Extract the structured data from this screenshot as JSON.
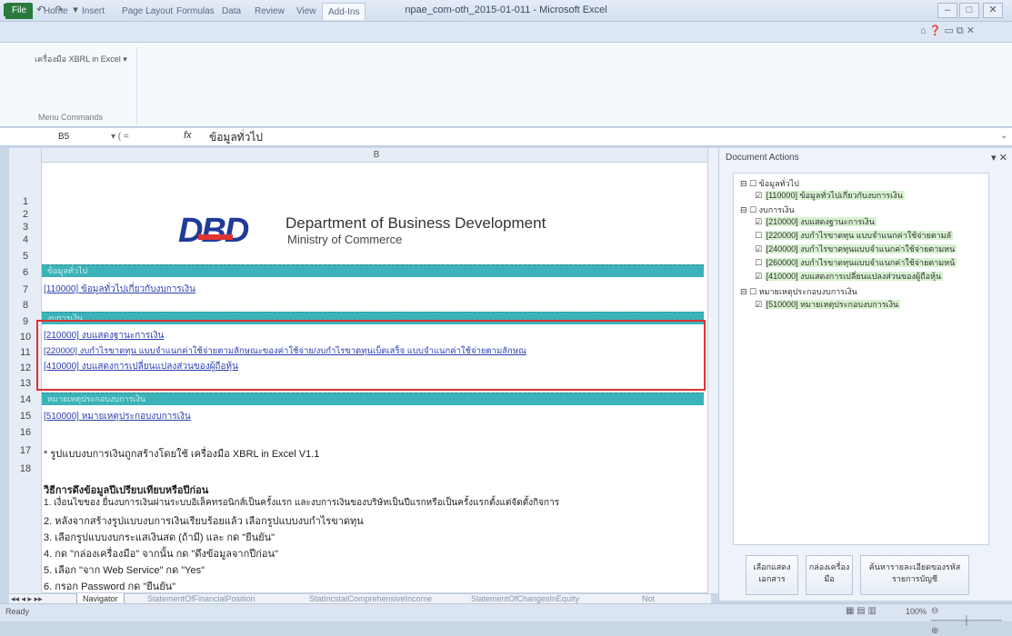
{
  "window": {
    "title": "npae_com-oth_2015-01-011 - Microsoft Excel"
  },
  "ribbon": {
    "file_tab": "File",
    "tabs": [
      "Home",
      "Insert",
      "Page Layout",
      "Formulas",
      "Data",
      "Review",
      "View",
      "Add-Ins"
    ],
    "addin_item": "เครื่องมือ XBRL in Excel",
    "group_label": "Menu Commands"
  },
  "formula_bar": {
    "cell_ref": "B5",
    "fx": "fx",
    "content": "ข้อมูลทั่วไป"
  },
  "grid": {
    "column_header": "B",
    "rows": [
      "1",
      "2",
      "3",
      "4",
      "5",
      "6",
      "7",
      "8",
      "9",
      "10",
      "11",
      "12",
      "13",
      "14",
      "15",
      "16",
      "17",
      "18"
    ],
    "logo_text": "DBD",
    "dept_name": "Department of Business Development",
    "ministry": "Ministry of Commerce",
    "section_general": "ข้อมูลทั่วไป",
    "link_110000": "[110000] ข้อมูลทั่วไปเกี่ยวกับงบการเงิน",
    "section_statements": "งบการเงิน",
    "link_210000": "[210000] งบแสดงฐานะการเงิน",
    "link_220000": "[220000] งบกำไรขาดทุน  แบบจำแนกค่าใช้จ่ายตามลักษณะของค่าใช้จ่าย/งบกำไรขาดทุนเบ็ดเสร็จ  แบบจำแนกค่าใช้จ่ายตามลักษณ",
    "link_410000": "[410000] งบแสดงการเปลี่ยนแปลงส่วนของผู้ถือหุ้น",
    "section_notes": "หมายเหตุประกอบงบการเงิน",
    "link_510000": "[510000] หมายเหตุประกอบงบการเงิน",
    "note_16": "* รูปแบบงบการเงินถูกสร้างโดยใช้ เครื่องมือ XBRL in Excel V1.1",
    "howto_title": "วิธีการดึงข้อมูลปีเปรียบเทียบหรือปีก่อน",
    "steps": [
      "1. เงื่อนไขของ ยื่นงบการเงินผ่านระบบอิเล็คทรอนิกส์เป็นครั้งแรก และงบการเงินของบริษัทเป็นปีแรกหรือเป็นครั้งแรกตั้งแต่จัดตั้งกิจการ",
      "2. หลังจากสร้างรูปแบบงบการเงินเรียบร้อยแล้ว เลือกรูปแบบงบกำไรขาดทุน",
      "3. เลือกรูปแบบงบกระแสเงินสด (ถ้ามี) และ กด \"ยืนยัน\"",
      "4. กด \"กล่องเครื่องมือ\" จากนั้น กด \"ดึงข้อมูลจากปีก่อน\"",
      "5. เลือก \"จาก Web Service\" กด \"Yes\"",
      "6. กรอก Password กด \"ยืนยัน\""
    ]
  },
  "sheet_tabs": [
    "Navigator",
    "StatementOfFinancialPosition",
    "StatIncstatComprehensiveIncome",
    "StatementOfChangesInEquity",
    "Not"
  ],
  "status": {
    "ready": "Ready",
    "zoom": "100%"
  },
  "document_actions": {
    "title": "Document Actions",
    "tree": [
      {
        "label": "ข้อมูลทั่วไป",
        "level": 0
      },
      {
        "label": "[110000] ข้อมูลทั่วไปเกี่ยวกับงบการเงิน",
        "level": 1,
        "checked": true,
        "selected": true
      },
      {
        "label": "งบการเงิน",
        "level": 0
      },
      {
        "label": "[210000] งบแสดงฐานะการเงิน",
        "level": 1,
        "checked": true,
        "selected": true
      },
      {
        "label": "[220000] งบกำไรขาดทุน แบบจำแนกค่าใช้จ่ายตามลั",
        "level": 1,
        "checked": false,
        "selected": true
      },
      {
        "label": "[240000] งบกำไรขาดทุนแบบจำแนกค่าใช้จ่ายตามหน",
        "level": 1,
        "checked": true,
        "selected": true
      },
      {
        "label": "[260000] งบกำไรขาดทุนแบบจำแนกค่าใช้จ่ายตามหน้",
        "level": 1,
        "checked": false,
        "selected": true
      },
      {
        "label": "[410000] งบแสดงการเปลี่ยนแปลงส่วนของผู้ถือหุ้น",
        "level": 1,
        "checked": true,
        "selected": true
      },
      {
        "label": "หมายเหตุประกอบงบการเงิน",
        "level": 0
      },
      {
        "label": "[510000] หมายเหตุประกอบงบการเงิน",
        "level": 1,
        "checked": true,
        "selected": true
      }
    ],
    "buttons": [
      "เลือกแสดงเอกสาร",
      "กล่องเครื่องมือ",
      "ค้นหารายละเอียดของรหัสรายการบัญชี"
    ]
  }
}
